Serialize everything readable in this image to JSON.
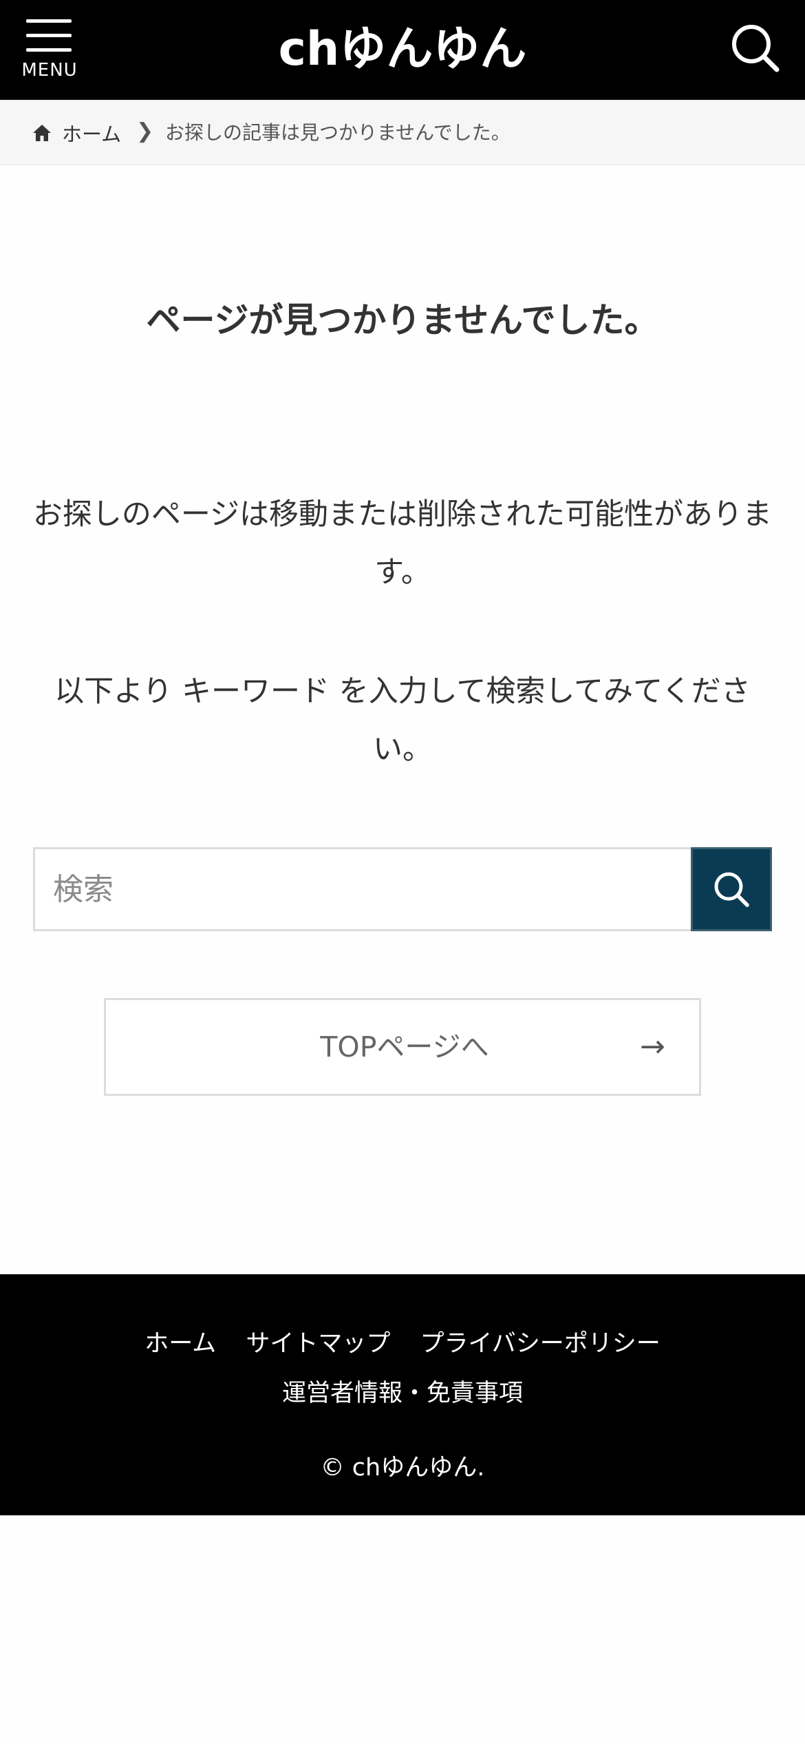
{
  "header": {
    "menu_label": "MENU",
    "site_title": "chゆんゆん",
    "icons": {
      "menu": "hamburger-icon",
      "search": "search-icon"
    },
    "background_color": "#000000"
  },
  "breadcrumb": {
    "home_label": "ホーム",
    "separator": "❯",
    "current": "お探しの記事は見つかりませんでした。"
  },
  "main": {
    "title": "ページが見つかりませんでした。",
    "message_1": "お探しのページは移動または削除された可能性があります。",
    "message_2": "以下より キーワード を入力して検索してみてください。",
    "search": {
      "placeholder": "検索",
      "value": "",
      "button_color": "#0a3b52"
    },
    "top_link": {
      "label": "TOPページへ",
      "arrow": "→"
    }
  },
  "footer": {
    "nav_row_1": [
      "ホーム",
      "サイトマップ",
      "プライバシーポリシー"
    ],
    "nav_row_2": [
      "運営者情報・免責事項"
    ],
    "copyright": "© chゆんゆん."
  }
}
